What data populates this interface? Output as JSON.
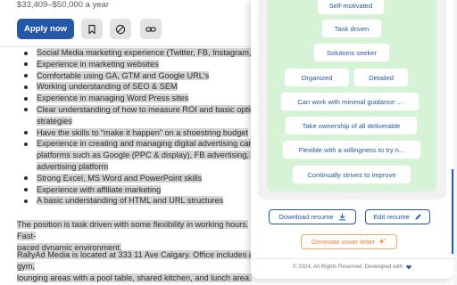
{
  "job": {
    "salary": "$33,409–$50,000 a year",
    "apply_label": "Apply now",
    "bullets": [
      "Social Media marketing experience (Twitter, FB, Instagram, Linkedin)",
      "Experience in marketing websites",
      "Comfortable using GA, GTM and Google URL's",
      "Working understanding of SEO & SEM",
      "Experience in managing Word Press sites",
      "Clear understanding of how to measure ROI and basic optimization",
      "strategies",
      "Have the skills to “make it happen” on a shoestring budget",
      "Experience in creating and managing digital advertising campaigns on",
      "platforms such as Google (PPC & display), FB advertising, or other",
      "advertising platform",
      "Strong Excel, MS Word and PowerPoint skills",
      "Experience with affiliate marketing",
      "A basic understanding of HTML and URL structures"
    ],
    "para1_line1": "The position is task driven with some flexibility in working hours. Fast-",
    "para1_line2": "paced dynamic environment.",
    "para2_line1": "RallyAd Media is located at 333 11 Ave Calgary. Office includes a gym,",
    "para2_line2": "lounging areas with a pool table, shared kitchen, and lunch area."
  },
  "panel": {
    "chips": [
      "Self-motivated",
      "Task driven",
      "Solutions seeker",
      "Organized",
      "Detailed",
      "Can work with minimal guidance ...",
      "Take ownership of all deliverable",
      "Flexible with a willingness to try n...",
      "Continually strives to improve"
    ],
    "download_label": "Download resume",
    "edit_label": "Edit resume",
    "cover_label": "Generate cover letter",
    "footer_text": "© 2024, All Rights Reserved, Developed with"
  },
  "colors": {
    "primary": "#2557a7",
    "chip_bg": "#d6f3d6",
    "cover_orange": "#e8822e",
    "highlight": "#d4d4d4"
  }
}
